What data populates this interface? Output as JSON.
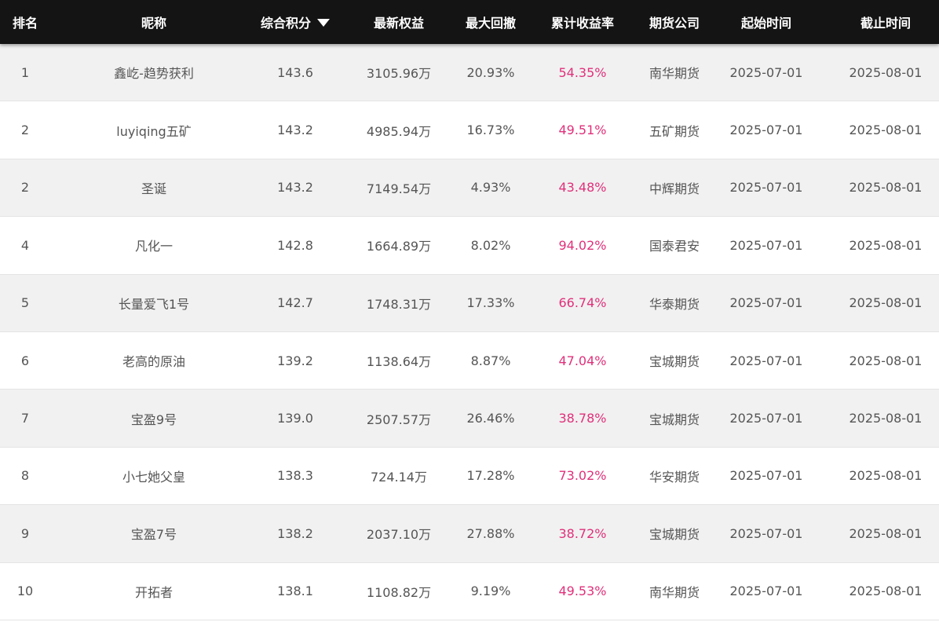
{
  "header": {
    "rank": "排名",
    "nickname": "昵称",
    "score": "综合积分",
    "equity": "最新权益",
    "max_drawdown": "最大回撤",
    "cumulative_return": "累计收益率",
    "company": "期货公司",
    "start": "起始时间",
    "end": "截止时间",
    "sort_icon": "sort-desc-icon"
  },
  "colors": {
    "header_bg": "#141414",
    "return_text": "#e0307a",
    "row_alt": "#f1f1f1"
  },
  "rows": [
    {
      "rank": "1",
      "nickname": "鑫屹-趋势获利",
      "score": "143.6",
      "equity": "3105.96万",
      "max_drawdown": "20.93%",
      "cumulative_return": "54.35%",
      "company": "南华期货",
      "start": "2025-07-01",
      "end": "2025-08-01"
    },
    {
      "rank": "2",
      "nickname": "luyiqing五矿",
      "score": "143.2",
      "equity": "4985.94万",
      "max_drawdown": "16.73%",
      "cumulative_return": "49.51%",
      "company": "五矿期货",
      "start": "2025-07-01",
      "end": "2025-08-01"
    },
    {
      "rank": "2",
      "nickname": "圣诞",
      "score": "143.2",
      "equity": "7149.54万",
      "max_drawdown": "4.93%",
      "cumulative_return": "43.48%",
      "company": "中辉期货",
      "start": "2025-07-01",
      "end": "2025-08-01"
    },
    {
      "rank": "4",
      "nickname": "凡化一",
      "score": "142.8",
      "equity": "1664.89万",
      "max_drawdown": "8.02%",
      "cumulative_return": "94.02%",
      "company": "国泰君安",
      "start": "2025-07-01",
      "end": "2025-08-01"
    },
    {
      "rank": "5",
      "nickname": "长量爱飞1号",
      "score": "142.7",
      "equity": "1748.31万",
      "max_drawdown": "17.33%",
      "cumulative_return": "66.74%",
      "company": "华泰期货",
      "start": "2025-07-01",
      "end": "2025-08-01"
    },
    {
      "rank": "6",
      "nickname": "老高的原油",
      "score": "139.2",
      "equity": "1138.64万",
      "max_drawdown": "8.87%",
      "cumulative_return": "47.04%",
      "company": "宝城期货",
      "start": "2025-07-01",
      "end": "2025-08-01"
    },
    {
      "rank": "7",
      "nickname": "宝盈9号",
      "score": "139.0",
      "equity": "2507.57万",
      "max_drawdown": "26.46%",
      "cumulative_return": "38.78%",
      "company": "宝城期货",
      "start": "2025-07-01",
      "end": "2025-08-01"
    },
    {
      "rank": "8",
      "nickname": "小七她父皇",
      "score": "138.3",
      "equity": "724.14万",
      "max_drawdown": "17.28%",
      "cumulative_return": "73.02%",
      "company": "华安期货",
      "start": "2025-07-01",
      "end": "2025-08-01"
    },
    {
      "rank": "9",
      "nickname": "宝盈7号",
      "score": "138.2",
      "equity": "2037.10万",
      "max_drawdown": "27.88%",
      "cumulative_return": "38.72%",
      "company": "宝城期货",
      "start": "2025-07-01",
      "end": "2025-08-01"
    },
    {
      "rank": "10",
      "nickname": "开拓者",
      "score": "138.1",
      "equity": "1108.82万",
      "max_drawdown": "9.19%",
      "cumulative_return": "49.53%",
      "company": "南华期货",
      "start": "2025-07-01",
      "end": "2025-08-01"
    }
  ]
}
